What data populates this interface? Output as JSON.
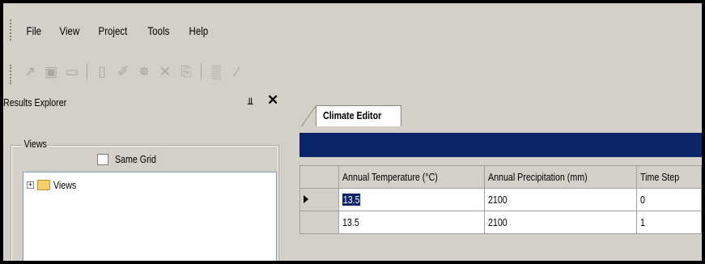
{
  "menu": {
    "items": [
      "File",
      "View",
      "Project",
      "Tools",
      "Help"
    ]
  },
  "toolbar": {
    "icons": [
      "open-icon",
      "save-icon",
      "folder-icon",
      "new-icon",
      "wand-icon",
      "run-icon",
      "delete-icon",
      "copy-icon",
      "chart-icon",
      "edit-icon"
    ]
  },
  "left_panel": {
    "title": "Results Explorer",
    "group_label": "Views",
    "checkbox_label": "Same Grid",
    "tree_root": "Views"
  },
  "editor": {
    "tab_label": "Climate Editor",
    "columns": [
      "Annual Temperature (°C)",
      "Annual Precipitation (mm)",
      "Time Step"
    ],
    "rows": [
      [
        "13.5",
        "2100",
        "0"
      ],
      [
        "13.5",
        "2100",
        "1"
      ]
    ]
  },
  "colors": {
    "chrome": "#d4d0c8",
    "caption": "#0b246a",
    "selection": "#0b246a"
  }
}
